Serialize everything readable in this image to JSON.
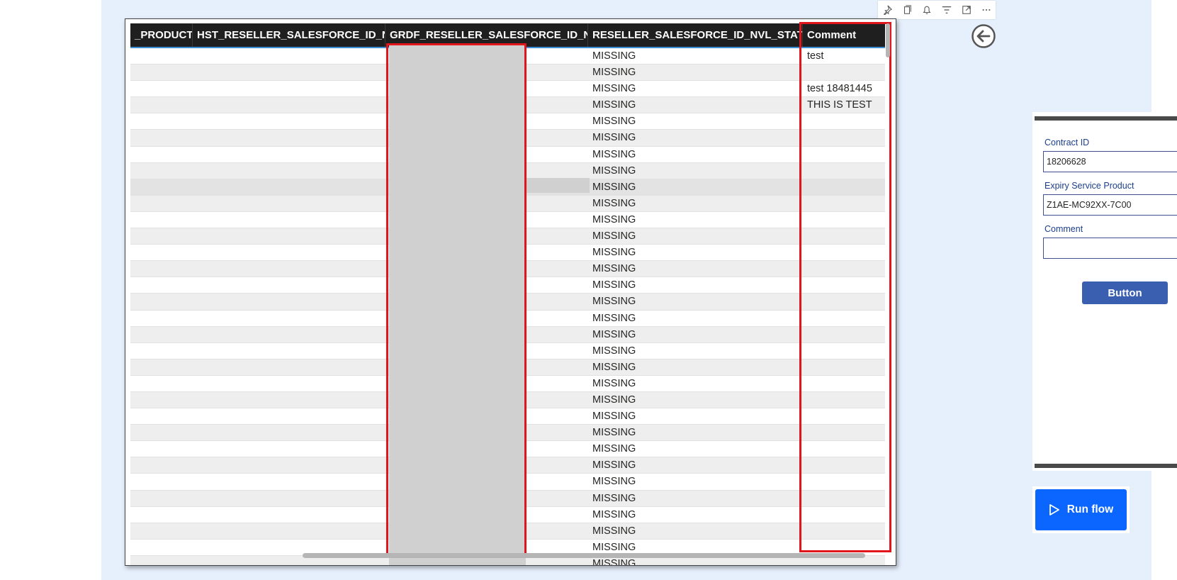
{
  "toolbar": {
    "icons": [
      "pin-icon",
      "copy-icon",
      "bell-icon",
      "filter-icon",
      "focus-mode-icon",
      "more-options-icon"
    ]
  },
  "table": {
    "columns": [
      "_PRODUCT",
      "HST_RESELLER_SALESFORCE_ID_NVL",
      "GRDF_RESELLER_SALESFORCE_ID_NVL",
      "RESELLER_SALESFORCE_ID_NVL_STATUS",
      "Comment"
    ],
    "rows": [
      {
        "status": "MISSING",
        "comment": "test"
      },
      {
        "status": "MISSING",
        "comment": ""
      },
      {
        "status": "MISSING",
        "comment": "test 18481445"
      },
      {
        "status": "MISSING",
        "comment": "THIS IS TEST"
      },
      {
        "status": "MISSING",
        "comment": ""
      },
      {
        "status": "MISSING",
        "comment": ""
      },
      {
        "status": "MISSING",
        "comment": ""
      },
      {
        "status": "MISSING",
        "comment": ""
      },
      {
        "status": "MISSING",
        "comment": ""
      },
      {
        "status": "MISSING",
        "comment": ""
      },
      {
        "status": "MISSING",
        "comment": ""
      },
      {
        "status": "MISSING",
        "comment": ""
      },
      {
        "status": "MISSING",
        "comment": ""
      },
      {
        "status": "MISSING",
        "comment": ""
      },
      {
        "status": "MISSING",
        "comment": ""
      },
      {
        "status": "MISSING",
        "comment": ""
      },
      {
        "status": "MISSING",
        "comment": ""
      },
      {
        "status": "MISSING",
        "comment": ""
      },
      {
        "status": "MISSING",
        "comment": ""
      },
      {
        "status": "MISSING",
        "comment": ""
      },
      {
        "status": "MISSING",
        "comment": ""
      },
      {
        "status": "MISSING",
        "comment": ""
      },
      {
        "status": "MISSING",
        "comment": ""
      },
      {
        "status": "MISSING",
        "comment": ""
      },
      {
        "status": "MISSING",
        "comment": ""
      },
      {
        "status": "MISSING",
        "comment": ""
      },
      {
        "status": "MISSING",
        "comment": ""
      },
      {
        "status": "MISSING",
        "comment": ""
      },
      {
        "status": "MISSING",
        "comment": ""
      },
      {
        "status": "MISSING",
        "comment": ""
      },
      {
        "status": "MISSING",
        "comment": ""
      },
      {
        "status": "MISSING",
        "comment": ""
      }
    ]
  },
  "form": {
    "contract_id_label": "Contract ID",
    "contract_id_value": "18206628",
    "expiry_label": "Expiry Service Product",
    "expiry_value": "Z1AE-MC92XX-7C00",
    "comment_label": "Comment",
    "comment_value": "",
    "button_label": "Button"
  },
  "run_flow_label": "Run flow",
  "colors": {
    "canvas": "#e6f0fc",
    "header": "#1f1f1f",
    "highlight_box": "#e0161c",
    "button": "#3a5fb0",
    "run_flow": "#0a66ff"
  }
}
